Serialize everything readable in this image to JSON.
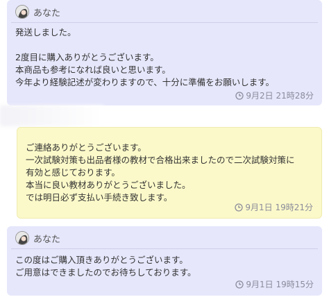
{
  "messages": [
    {
      "sender": "あなた",
      "show_header": true,
      "body": "発送しました。\n\n2度目に購入ありがとうございます。\n本商品も参考になれば良いと思います。\n今年より経験記述が変わりますので、十分に準備をお願いします。",
      "time": "9月2日 21時28分"
    },
    {
      "sender": "",
      "show_header": false,
      "body": "ご連絡ありがとうございます。\n一次試験対策も出品者様の教材で合格出来ましたので二次試験対策に\n有効と感じております。\n本当に良い教材ありがとうございました。\nでは明日必ず支払い手続き致します。",
      "time": "9月1日 19時21分"
    },
    {
      "sender": "あなた",
      "show_header": true,
      "body": "この度はご購入頂きありがとうございます。\nご用意はできましたのでお待ちしております。",
      "time": "9月1日 19時15分"
    }
  ],
  "colors": {
    "mine_bg": "#e6e7fb",
    "other_bg": "#fbf9c9",
    "time_text": "#8b8b9b"
  },
  "icons": {
    "avatar": "avatar-image",
    "clock": "clock-icon"
  }
}
